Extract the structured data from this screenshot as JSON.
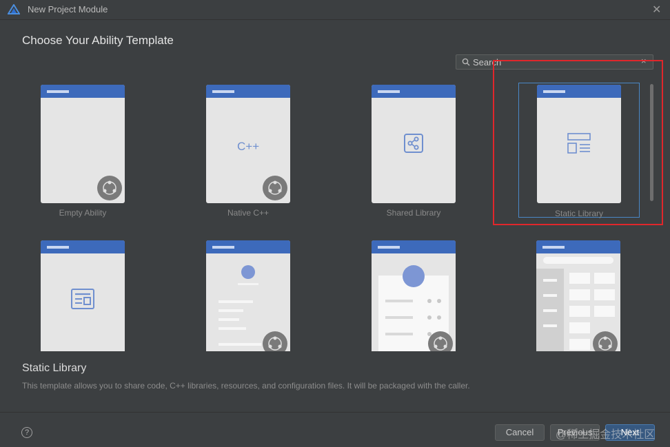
{
  "window": {
    "title": "New Project Module"
  },
  "heading": "Choose Your Ability Template",
  "search": {
    "value": "",
    "placeholder": "Search",
    "clear_glyph": "×"
  },
  "templates": [
    {
      "label": "Empty Ability",
      "icon": "empty-ability-preview",
      "selected": false
    },
    {
      "label": "Native C++",
      "icon": "cpp-icon",
      "art_text": "C++",
      "selected": false
    },
    {
      "label": "Shared Library",
      "icon": "share-icon",
      "selected": false
    },
    {
      "label": "Static Library",
      "icon": "library-layout-icon",
      "selected": true
    },
    {
      "label": "",
      "icon": "form-card-icon",
      "selected": false
    },
    {
      "label": "",
      "icon": "profile-list-preview",
      "selected": false
    },
    {
      "label": "",
      "icon": "avatar-detail-preview",
      "selected": false
    },
    {
      "label": "",
      "icon": "grid-layout-preview",
      "selected": false
    }
  ],
  "description": {
    "title": "Static Library",
    "text": "This template allows you to share code, C++ libraries, resources, and configuration files. It will be packaged with the caller."
  },
  "footer": {
    "help_glyph": "?",
    "cancel_label": "Cancel",
    "previous_label": "Previous",
    "next_label": "Next",
    "watermark": "@稀土掘金技术社区"
  },
  "colors": {
    "background": "#3c3f41",
    "card_header": "#3d6abb",
    "accent_icon": "#6f8fcf",
    "selection_border": "#4a88c7",
    "highlight_box": "#e0262b",
    "primary_button": "#365880"
  }
}
